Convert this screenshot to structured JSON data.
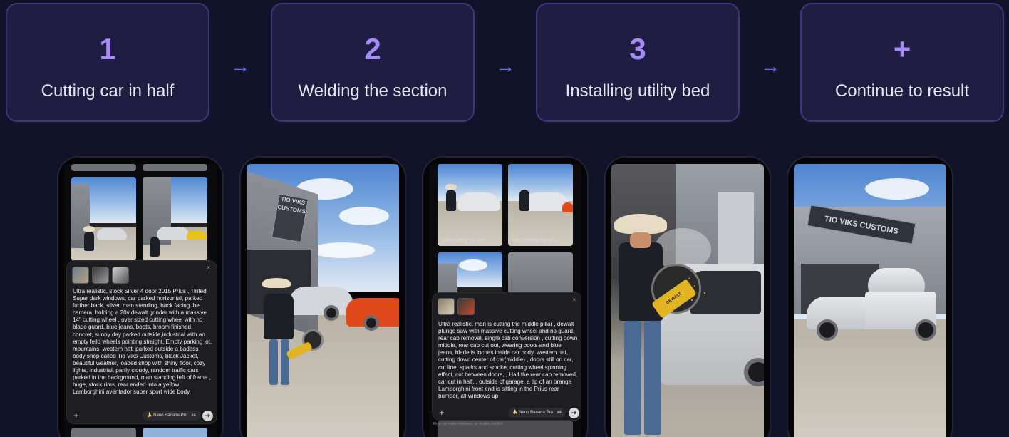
{
  "steps": [
    {
      "number": "1",
      "label": "Cutting car in half"
    },
    {
      "number": "2",
      "label": "Welding the section"
    },
    {
      "number": "3",
      "label": "Installing utility bed"
    },
    {
      "number": "+",
      "label": "Continue to result"
    }
  ],
  "arrow_glyph": "→",
  "colors": {
    "background": "#111428",
    "card": "#1f1e42",
    "card_border": "#3b3877",
    "accent": "#a78bfa",
    "arrow": "#6c6fe6"
  },
  "phones": {
    "phone1": {
      "prompt": "Ultra realistic, stock Silver 4 door 2015 Prius , Tinted Super dark windows, car parked horizontal, parked further back, silver, man standing, back facing the camera, holding a  20v dewalt  grinder with a massive 14\" cutting wheel , over sized cutting wheel with no blade guard, blue jeans, boots, broom finished concret, sunny day parked outside,industrial with an empty feild wheels pointing straight, Empty parking lot, mountains, western hat, parked outside a badass body shop called Tio Viks Customs, black Jacket, beautiful weather, loaded shop with shiny floor, cozy lights, industrial, partly cloudy, random traffic cars parked in the background, man standing left of frame , huge, stock rims, rear ended into a yellow Lamborghini aventador super sport wide body,",
      "model": "🍌 Nano Banana Pro",
      "count": "x4",
      "close": "×",
      "add": "+",
      "send": "➔"
    },
    "phone2": {
      "sign": "TIO VIKS CUSTOMS"
    },
    "phone3": {
      "tile_caption_1": "Man cutting car wit...",
      "tile_caption_2": "Man cutting car wit...",
      "prompt": "Ultra realistic, man is cutting the middle pillar , dewalt plunge saw with massive cutting wheel and no guard, rear cab removal, single cab conversion , cutting down middle, rear cab cut out, wearing boots and blue jeans, blade is inches inside car body, western hat, cutting down center of car(middle) , doors still on car, cut line, sparks and smoke, cutting wheel spinning effect, cut between doors, ,  Half the rear cab removed, car cut in half, , outside of garage, a tip of an orange Lamborghini front end is sitting in the Prius rear bumper, all windows up",
      "model": "🍌 Nano Banana Pro",
      "count": "x4",
      "close": "×",
      "add": "+",
      "send": "➔",
      "footnote": "Flow can make mistakes, so double check it"
    },
    "phone4": {
      "saw_brand": "DEWALT"
    },
    "phone5": {
      "sign": "TIO VIKS CUSTOMS"
    }
  }
}
